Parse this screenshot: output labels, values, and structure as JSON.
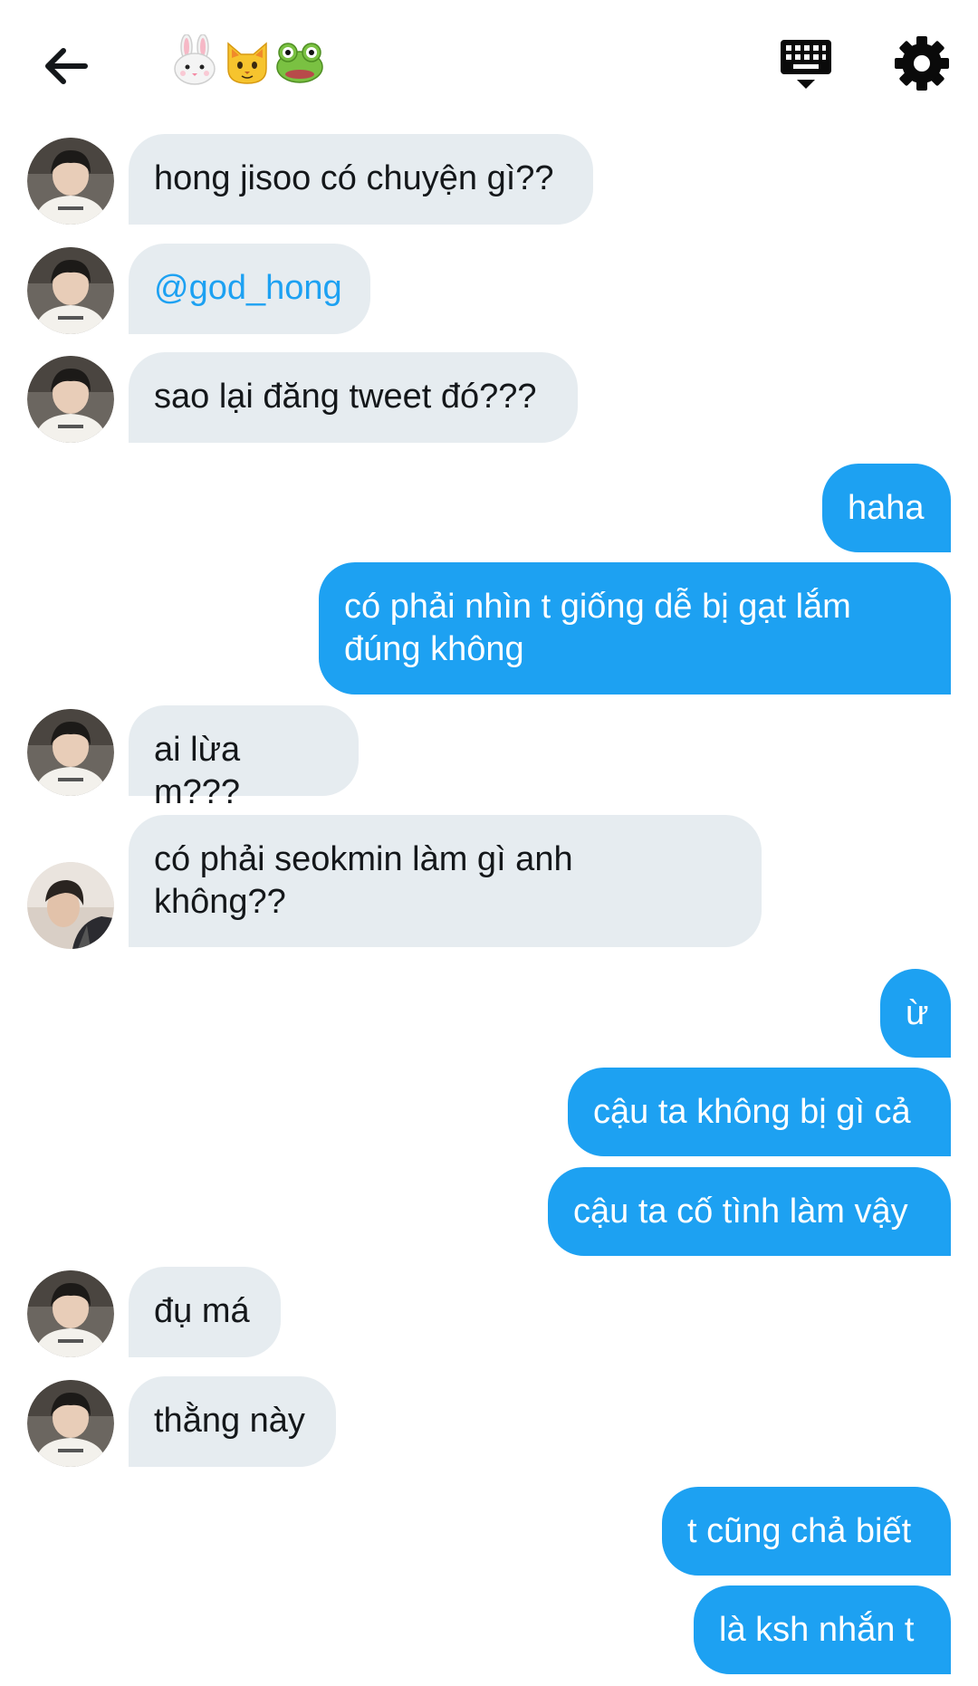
{
  "header": {
    "back_icon": "arrow-left-icon",
    "title_emojis": [
      "rabbit-face",
      "cat-face",
      "frog-face"
    ],
    "keyboard_icon": "keyboard-hide-icon",
    "settings_icon": "gear-icon"
  },
  "messages": [
    {
      "side": "in",
      "text": "hong jisoo có chuyện gì??",
      "avatar": "avatar-a"
    },
    {
      "side": "in",
      "text": "@god_hong",
      "avatar": "avatar-a",
      "mention": true
    },
    {
      "side": "in",
      "text": "sao lại đăng tweet đó???",
      "avatar": "avatar-a"
    },
    {
      "side": "out",
      "text": "haha"
    },
    {
      "side": "out",
      "text_line1": "có phải nhìn t giống dễ bị gạt lắm",
      "text_line2": "đúng không"
    },
    {
      "side": "in",
      "text": "ai lừa m???",
      "avatar": "avatar-a"
    },
    {
      "side": "in",
      "text_line1": "có phải seokmin làm gì anh",
      "text_line2": "không??",
      "avatar": "avatar-b"
    },
    {
      "side": "out",
      "text": "ừ"
    },
    {
      "side": "out",
      "text": "cậu ta không bị gì cả"
    },
    {
      "side": "out",
      "text": "cậu ta cố tình làm vậy"
    },
    {
      "side": "in",
      "text": "đụ má",
      "avatar": "avatar-a"
    },
    {
      "side": "in",
      "text": "thằng này",
      "avatar": "avatar-a"
    },
    {
      "side": "out",
      "text": "t cũng chả biết"
    },
    {
      "side": "out",
      "text": "là ksh nhắn t"
    }
  ],
  "colors": {
    "outgoing_bubble": "#1da1f2",
    "incoming_bubble": "#e6ecf0",
    "mention": "#1da1f2",
    "text": "#14171a"
  }
}
